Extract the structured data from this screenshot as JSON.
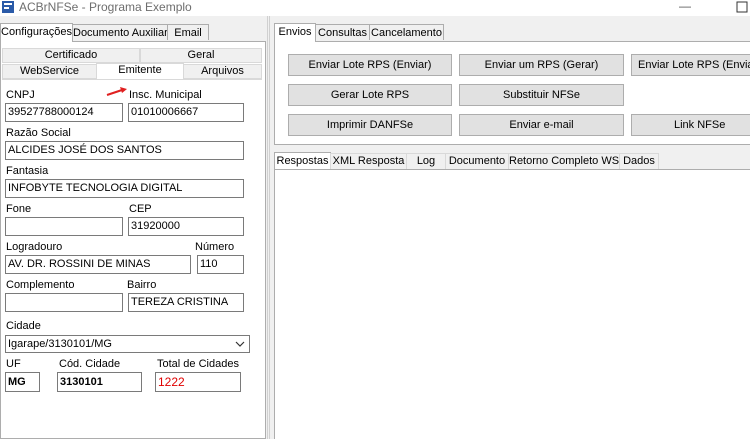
{
  "window": {
    "title": "ACBrNFSe - Programa Exemplo",
    "minimize_glyph": "—",
    "app_icon": "app-icon",
    "maximize_icon": "maximize-icon"
  },
  "left_tabs": [
    "Configurações",
    "Documento Auxiliar",
    "Email"
  ],
  "config_tabs": {
    "row1": [
      "Certificado",
      "Geral"
    ],
    "row2": [
      "WebService",
      "Emitente",
      "Arquivos"
    ]
  },
  "emitente": {
    "cnpj_label": "CNPJ",
    "cnpj": "39527788000124",
    "im_label": "Insc. Municipal",
    "im": "01010006667",
    "razao_label": "Razão Social",
    "razao": "ALCIDES JOSÉ DOS SANTOS",
    "fantasia_label": "Fantasia",
    "fantasia": "INFOBYTE TECNOLOGIA DIGITAL",
    "fone_label": "Fone",
    "fone": "",
    "cep_label": "CEP",
    "cep": "31920000",
    "logradouro_label": "Logradouro",
    "logradouro": "AV. DR. ROSSINI DE MINAS",
    "numero_label": "Número",
    "numero": "110",
    "complemento_label": "Complemento",
    "complemento": "",
    "bairro_label": "Bairro",
    "bairro": "TEREZA CRISTINA",
    "cidade_label": "Cidade",
    "cidade": "Igarape/3130101/MG",
    "uf_label": "UF",
    "uf": "MG",
    "cod_cidade_label": "Cód. Cidade",
    "cod_cidade": "3130101",
    "total_cidades_label": "Total de Cidades",
    "total_cidades": "1222",
    "total_color": "#e00000"
  },
  "right_tabs": [
    "Envios",
    "Consultas",
    "Cancelamento"
  ],
  "buttons": {
    "enviar_lote": "Enviar Lote RPS (Enviar)",
    "enviar_um": "Enviar um RPS (Gerar)",
    "enviar_lote_sinc": "Enviar Lote RPS (EnviarS",
    "gerar_lote": "Gerar Lote RPS",
    "substituir": "Substituir NFSe",
    "imprimir": "Imprimir DANFSe",
    "enviar_email": "Enviar e-mail",
    "link": "Link NFSe"
  },
  "bottom_tabs": [
    "Respostas",
    "XML Resposta",
    "Log",
    "Documento",
    "Retorno Completo WS",
    "Dados"
  ],
  "annotation": {
    "arrow_color": "#e02020"
  }
}
